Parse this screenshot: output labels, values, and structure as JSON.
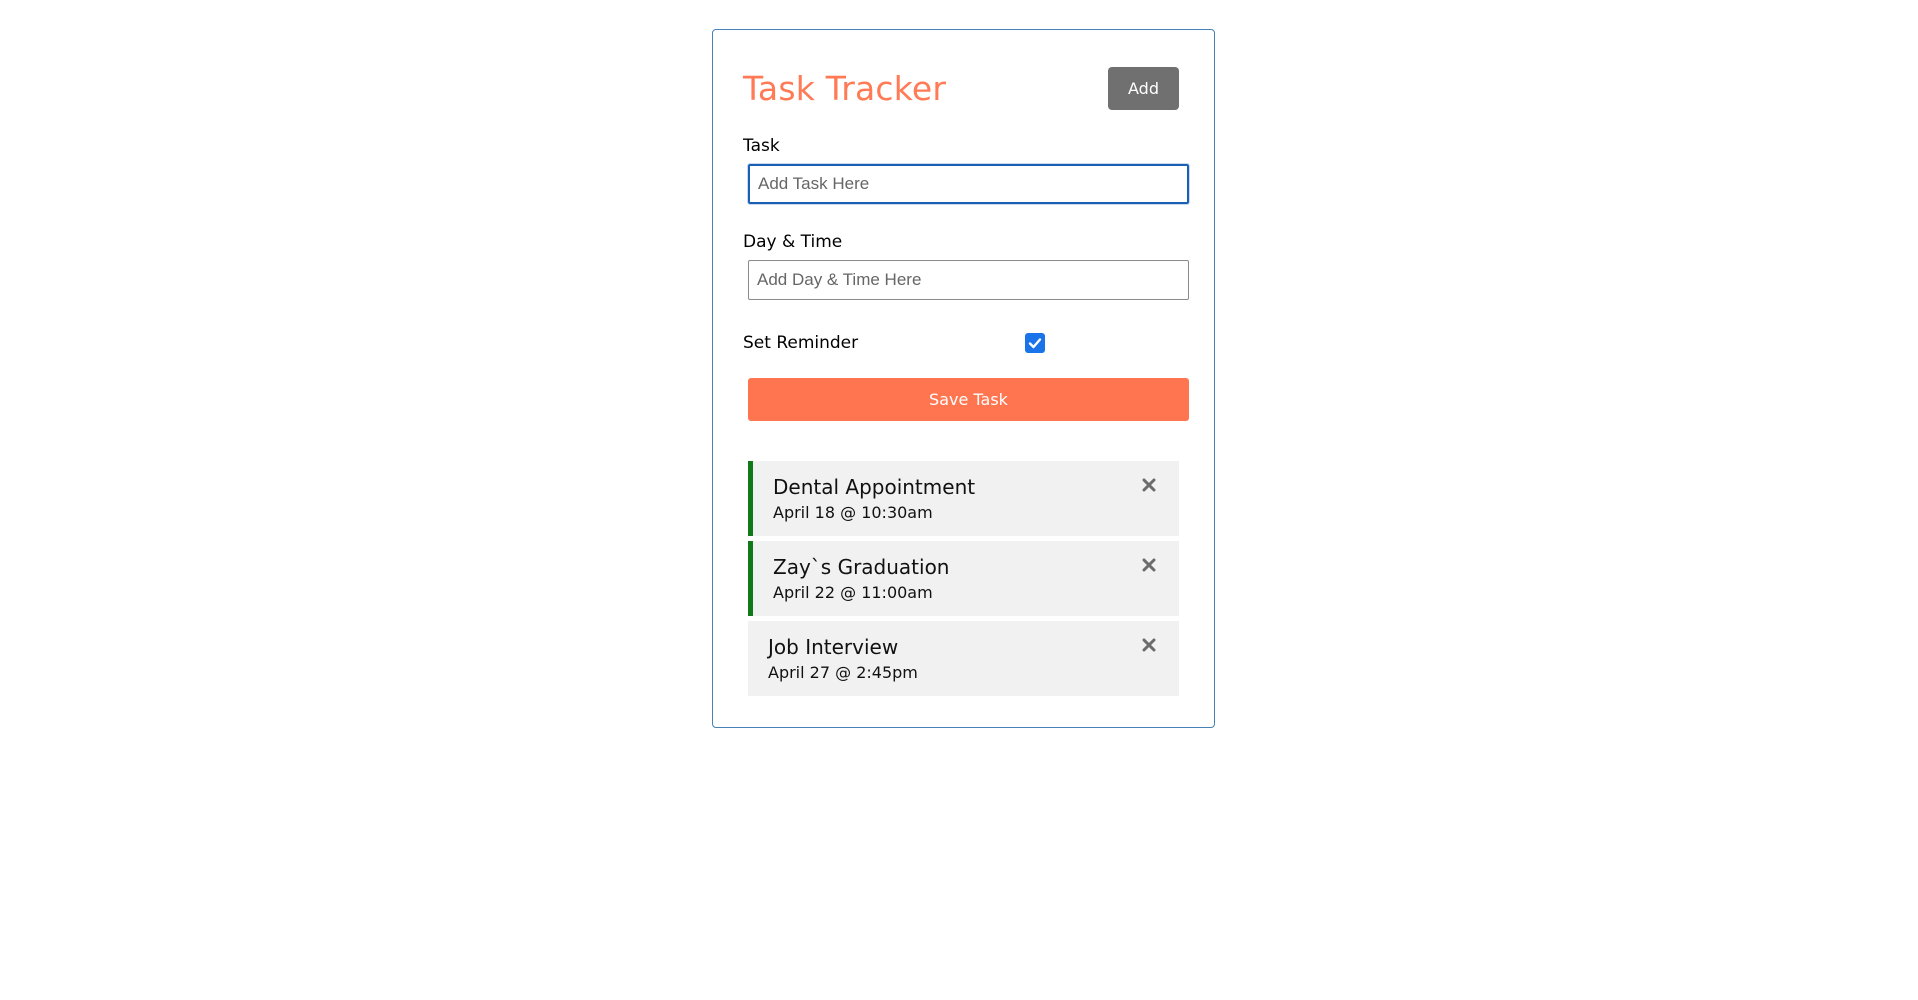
{
  "header": {
    "title": "Task Tracker",
    "add_label": "Add"
  },
  "form": {
    "task_label": "Task",
    "task_placeholder": "Add Task Here",
    "day_label": "Day & Time",
    "day_placeholder": "Add Day & Time Here",
    "reminder_label": "Set Reminder",
    "reminder_checked": true,
    "save_label": "Save Task"
  },
  "tasks": [
    {
      "text": "Dental Appointment",
      "day": "April 18 @ 10:30am",
      "reminder": true
    },
    {
      "text": "Zay`s Graduation",
      "day": "April 22 @ 11:00am",
      "reminder": true
    },
    {
      "text": "Job Interview",
      "day": "April 27 @ 2:45pm",
      "reminder": false
    }
  ],
  "colors": {
    "accent": "#ff7550",
    "title": "#ff7a55",
    "reminder_border": "#0f7a17",
    "container_border": "#4682b4",
    "add_button": "#707070",
    "checkbox": "#1a73e8"
  },
  "icons": {
    "delete": "close-icon",
    "checkbox": "checkmark-icon"
  }
}
